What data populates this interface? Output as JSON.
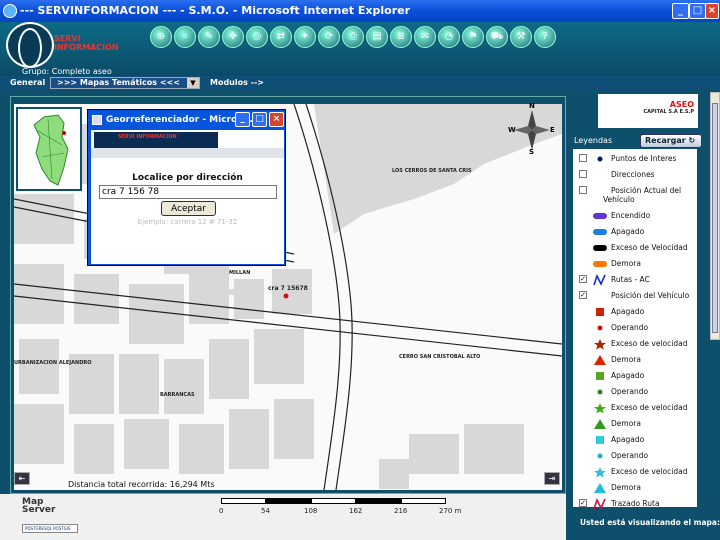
{
  "window": {
    "title": "--- SERVINFORMACION --- - S.M.O. - Microsoft Internet Explorer"
  },
  "header": {
    "brand_line1": "SERVI",
    "brand_line2": "INFORMACION",
    "grupo": "Grupo: Completo aseo",
    "toolbar_icons": [
      "zoom-icon",
      "search-icon",
      "measure-icon",
      "pan-icon",
      "locate-icon",
      "route-icon",
      "gps-icon",
      "refresh-icon",
      "print-icon",
      "layers-icon",
      "report-icon",
      "mail-icon",
      "stats-icon",
      "flag-icon",
      "vehicle-icon",
      "tools-icon",
      "help-icon"
    ]
  },
  "nav": {
    "general": "General",
    "select_value": ">>> Mapas Temáticos <<<",
    "modulos": "Modulos -->"
  },
  "map": {
    "labels": {
      "los_cerros": "LOS CERROS DE SANTA CRIS",
      "millan": "MILLAN",
      "point": "cra 7 15678",
      "cerro_san_cristobal": "CERRO SAN CRISTOBAL ALTO",
      "urbanizacion": "URBANIZACION ALEJANDRO",
      "barrancas": "BARRANCAS"
    },
    "compass": {
      "n": "N",
      "s": "S",
      "e": "E",
      "w": "W"
    },
    "distance": "Distancia total recorrida: 16,294 Mts"
  },
  "dialog": {
    "title": "Georreferenciador - Micros...",
    "banner": "SERVI INFORMACION",
    "heading": "Localice por dirección",
    "input_value": "cra 7 156 78",
    "button": "Aceptar",
    "example": "Ejemplo: carrera 12 # 71-32"
  },
  "footer": {
    "logo_line1": "Map",
    "logo_line2": "Server",
    "scale_labels": [
      "0",
      "54",
      "108",
      "162",
      "216",
      "270 m"
    ],
    "powered": "POSTGRESQL  POSTGIS"
  },
  "right": {
    "brand": "ASEO",
    "brand_sub": "CAPITAL S.A E.S.P",
    "legend_tab": "Leyendas",
    "reload": "Recargar",
    "status": "Usted está visualizando el mapa:"
  },
  "legend": [
    {
      "label": "Puntos de Interes",
      "check": "unchecked",
      "icon": "dot-icon",
      "color": "#001a66"
    },
    {
      "label": "Direcciones",
      "check": "unchecked",
      "icon": "none",
      "color": "#000000"
    },
    {
      "label": "Posición Actual del",
      "label2": "Vehículo",
      "check": "unchecked",
      "icon": "none",
      "color": "#000000"
    },
    {
      "label": "Encendido",
      "check": "none",
      "icon": "car-icon",
      "color": "#6633cc"
    },
    {
      "label": "Apagado",
      "check": "none",
      "icon": "car-icon",
      "color": "#1a7fe0"
    },
    {
      "label": "Exceso de Velocidad",
      "check": "none",
      "icon": "car-icon",
      "color": "#000000"
    },
    {
      "label": "Demora",
      "check": "none",
      "icon": "car-icon",
      "color": "#ff7700"
    },
    {
      "label": "Rutas - AC",
      "check": "checked",
      "icon": "route-line-icon",
      "color": "#1a2bd0"
    },
    {
      "label": "Posición del Vehículo",
      "check": "checked",
      "icon": "none",
      "color": "#000000"
    },
    {
      "label": "Apagado",
      "check": "none",
      "icon": "square-icon",
      "color": "#cc2200"
    },
    {
      "label": "Operando",
      "check": "none",
      "icon": "dot-icon",
      "color": "#cc1100"
    },
    {
      "label": "Exceso de velocidad",
      "check": "none",
      "icon": "star-icon",
      "color": "#aa2200"
    },
    {
      "label": "Demora",
      "check": "none",
      "icon": "triangle-icon",
      "color": "#dd2200"
    },
    {
      "label": "Apagado",
      "check": "none",
      "icon": "square-icon",
      "color": "#55aa22"
    },
    {
      "label": "Operando",
      "check": "none",
      "icon": "dot-icon",
      "color": "#338822"
    },
    {
      "label": "Exceso de velocidad",
      "check": "none",
      "icon": "star-icon",
      "color": "#44aa11"
    },
    {
      "label": "Demora",
      "check": "none",
      "icon": "triangle-icon",
      "color": "#339922"
    },
    {
      "label": "Apagado",
      "check": "none",
      "icon": "square-icon",
      "color": "#33ccdd"
    },
    {
      "label": "Operando",
      "check": "none",
      "icon": "dot-icon",
      "color": "#22aacc"
    },
    {
      "label": "Exceso de velocidad",
      "check": "none",
      "icon": "star-icon",
      "color": "#33bbdd"
    },
    {
      "label": "Demora",
      "check": "none",
      "icon": "triangle-icon",
      "color": "#22bbdd"
    },
    {
      "label": "Trazado Ruta",
      "check": "checked",
      "icon": "route-line-icon",
      "color": "#cc1144"
    }
  ]
}
